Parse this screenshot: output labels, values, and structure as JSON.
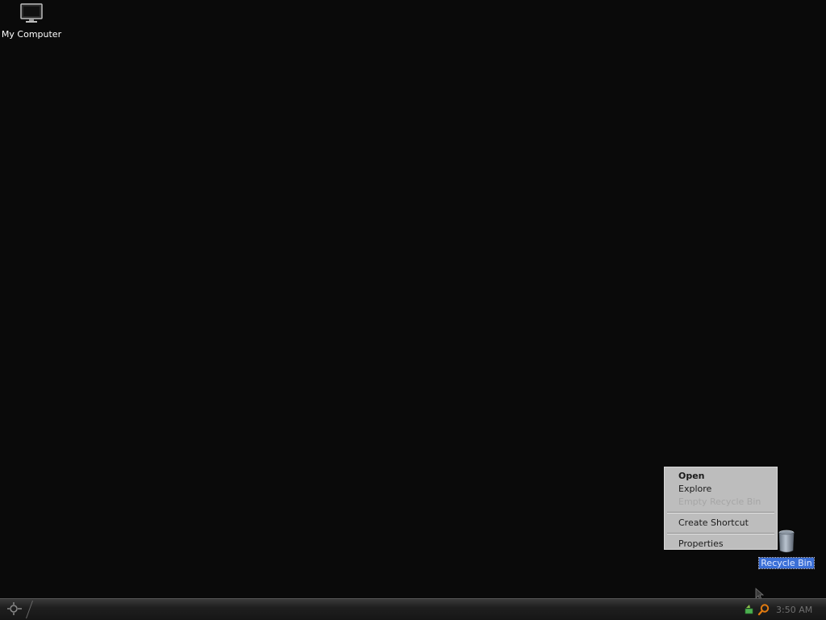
{
  "desktop": {
    "icons": [
      {
        "label": "My Computer",
        "icon": "monitor-icon"
      },
      {
        "label": "Recycle Bin",
        "icon": "recycle-bin-icon"
      }
    ]
  },
  "context_menu": {
    "items": [
      {
        "label": "Open",
        "bold": true,
        "disabled": false
      },
      {
        "label": "Explore",
        "bold": false,
        "disabled": false
      },
      {
        "label": "Empty Recycle Bin",
        "bold": false,
        "disabled": true
      },
      {
        "label": "Create Shortcut",
        "bold": false,
        "disabled": false
      },
      {
        "label": "Properties",
        "bold": false,
        "disabled": false
      }
    ]
  },
  "taskbar": {
    "start_icon": "start-gear-icon",
    "tray_icons": [
      "safely-remove-hardware-icon",
      "search-icon"
    ],
    "clock": "3:50 AM"
  },
  "colors": {
    "desktop_bg": "#0a0a0a",
    "menu_bg": "#bdbdbd",
    "selection": "#3b6fd6",
    "search_orange": "#e07a10"
  }
}
